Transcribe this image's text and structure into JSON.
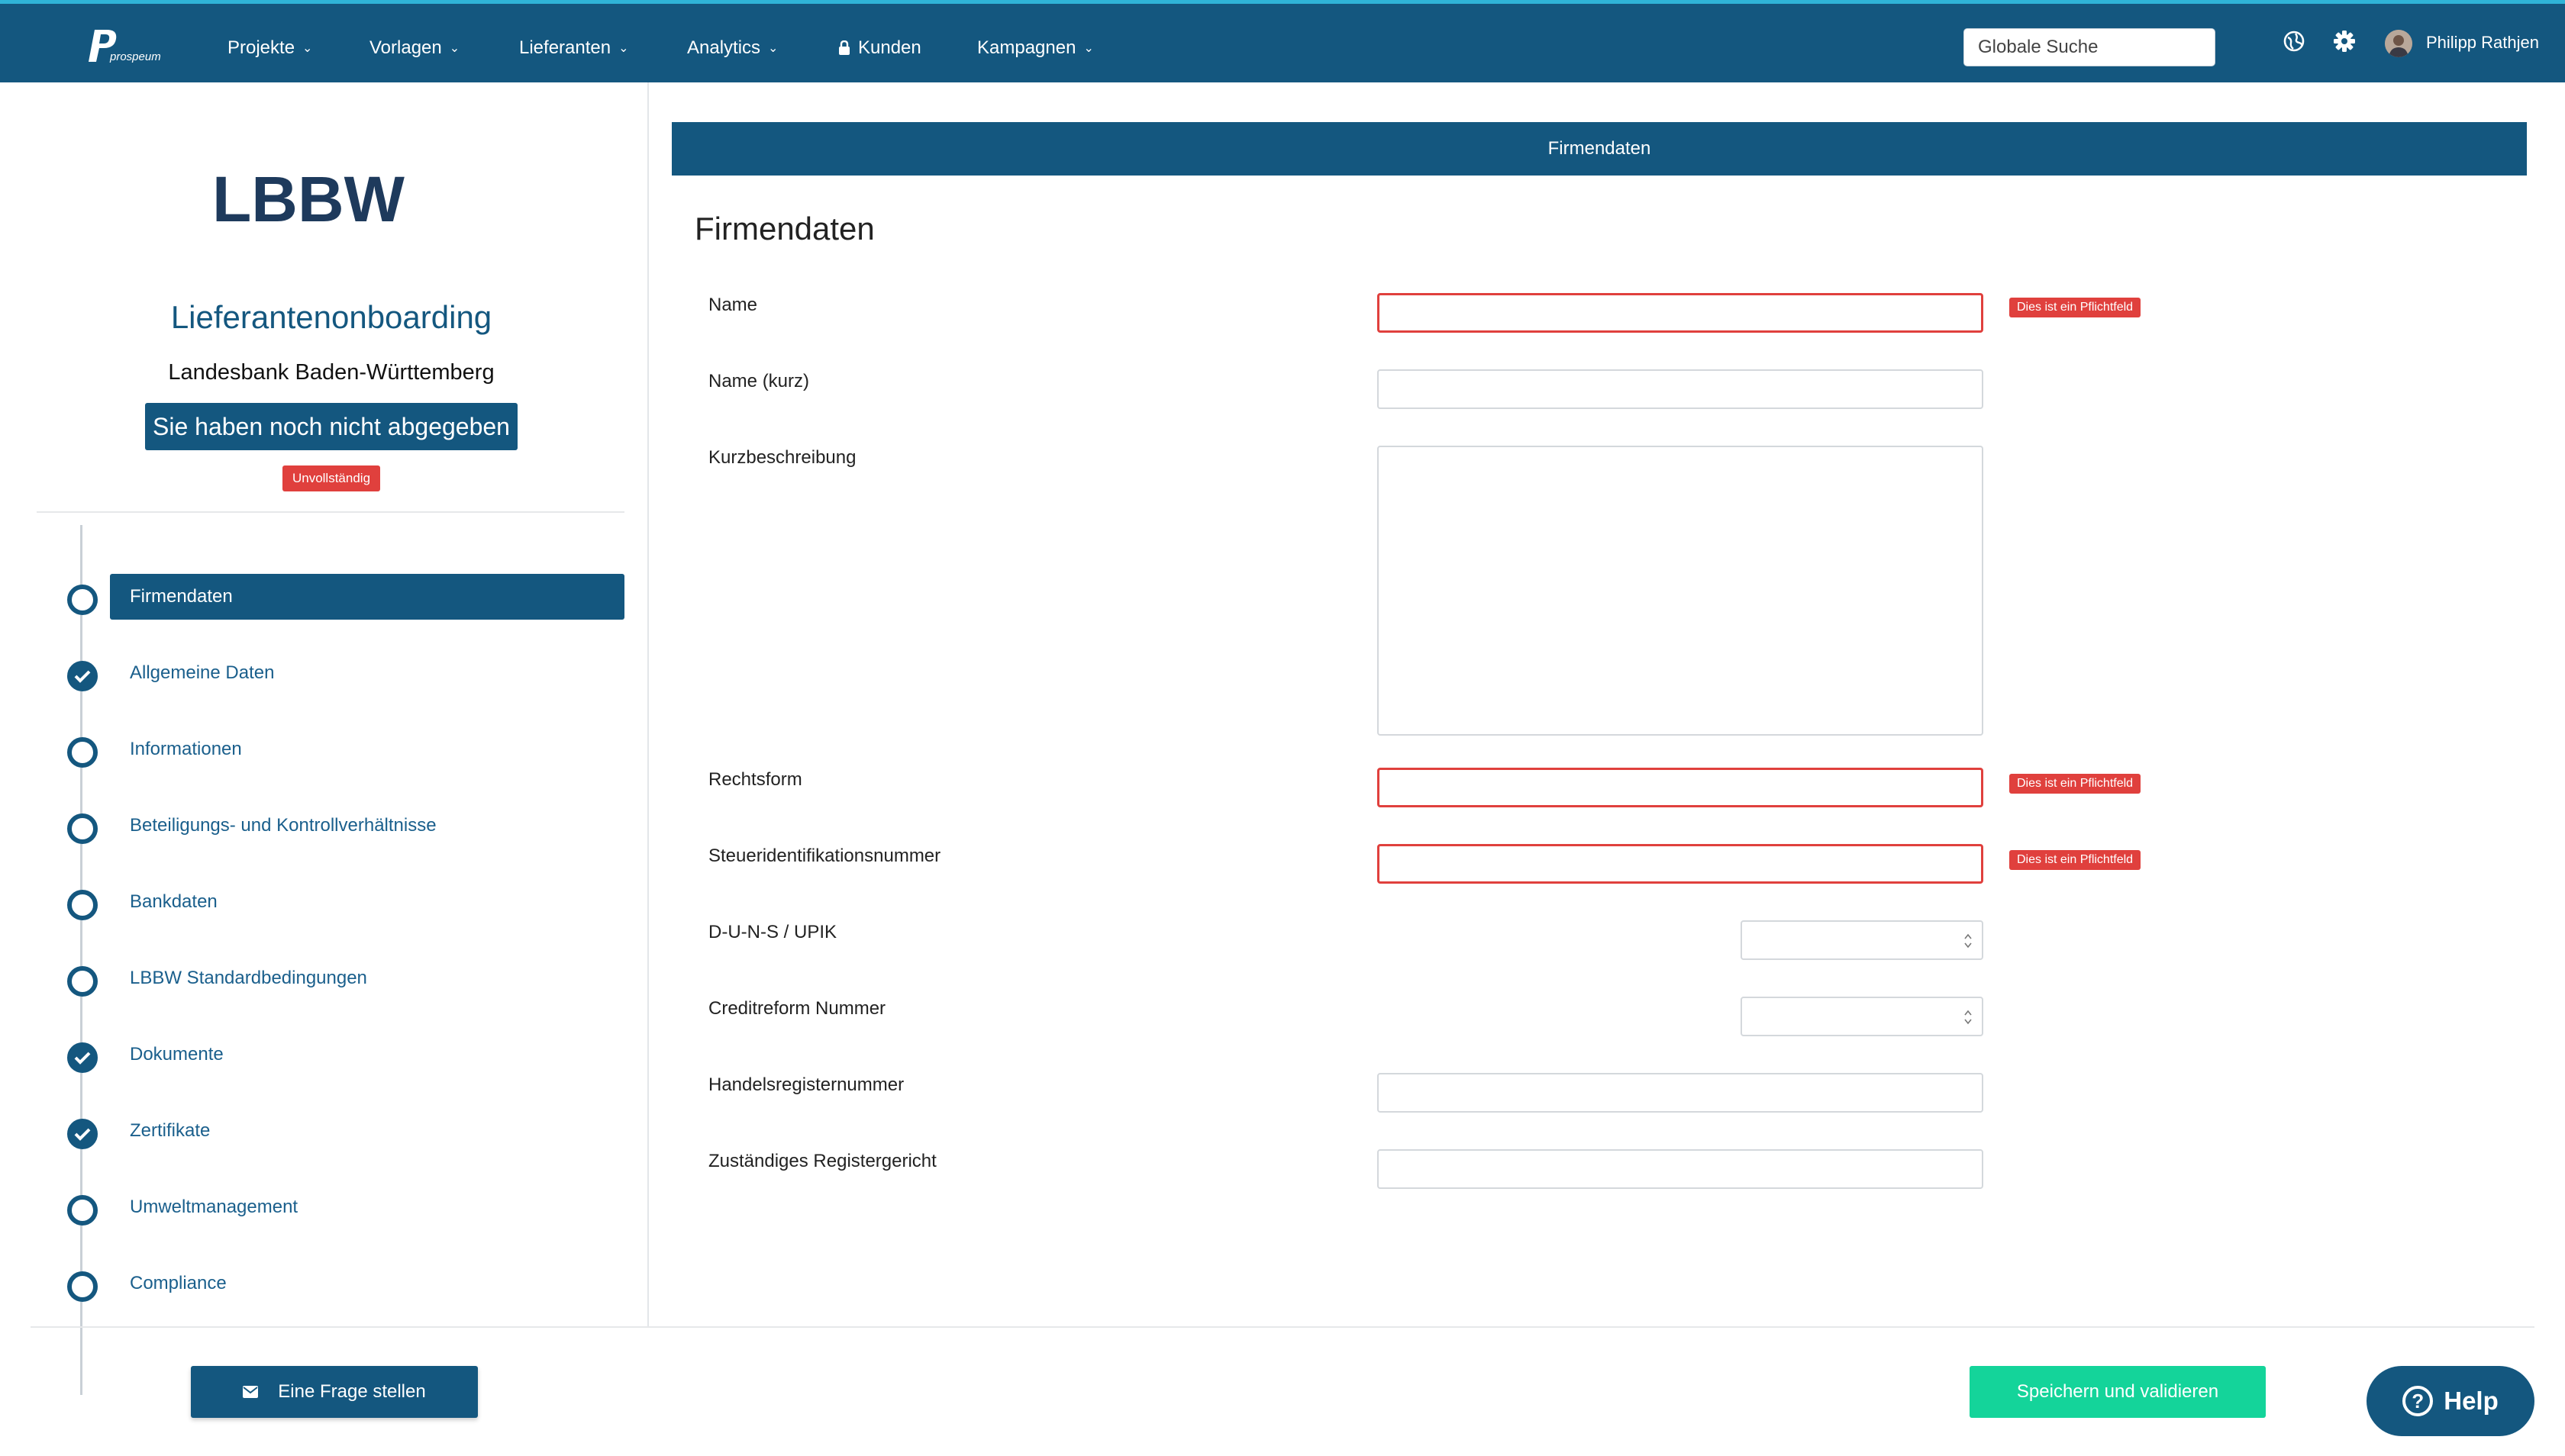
{
  "nav": {
    "logo_text": "prospeum",
    "items": [
      {
        "label": "Projekte",
        "has_caret": true
      },
      {
        "label": "Vorlagen",
        "has_caret": true
      },
      {
        "label": "Lieferanten",
        "has_caret": true
      },
      {
        "label": "Analytics",
        "has_caret": true
      },
      {
        "label": "Kunden",
        "has_caret": false,
        "icon": "lock-icon"
      },
      {
        "label": "Kampagnen",
        "has_caret": true
      }
    ],
    "search_placeholder": "Globale Suche",
    "icons": [
      "globe-icon",
      "gear-icon"
    ],
    "user_name": "Philipp Rathjen"
  },
  "sidebar": {
    "client_logo_text": "LBBW",
    "title": "Lieferantenonboarding",
    "bank_name": "Landesbank Baden-Württemberg",
    "submission_status": "Sie haben noch nicht abgegeben",
    "completion_badge": "Unvollständig",
    "steps": [
      {
        "label": "Firmendaten",
        "done": false,
        "active": true
      },
      {
        "label": "Allgemeine Daten",
        "done": true,
        "active": false
      },
      {
        "label": "Informationen",
        "done": false,
        "active": false
      },
      {
        "label": "Beteiligungs- und Kontrollverhältnisse",
        "done": false,
        "active": false
      },
      {
        "label": "Bankdaten",
        "done": false,
        "active": false
      },
      {
        "label": "LBBW Standardbedingungen",
        "done": false,
        "active": false
      },
      {
        "label": "Dokumente",
        "done": true,
        "active": false
      },
      {
        "label": "Zertifikate",
        "done": true,
        "active": false
      },
      {
        "label": "Umweltmanagement",
        "done": false,
        "active": false
      },
      {
        "label": "Compliance",
        "done": false,
        "active": false
      }
    ]
  },
  "main": {
    "header": "Firmendaten",
    "title": "Firmendaten",
    "required_message": "Dies ist ein Pflichtfeld",
    "fields": [
      {
        "label": "Name",
        "value": "",
        "type": "text",
        "required_error": true
      },
      {
        "label": "Name (kurz)",
        "value": "",
        "type": "text",
        "required_error": false
      },
      {
        "label": "Kurzbeschreibung",
        "value": "",
        "type": "textarea",
        "required_error": false
      },
      {
        "label": "Rechtsform",
        "value": "",
        "type": "text",
        "required_error": true
      },
      {
        "label": "Steueridentifikationsnummer",
        "value": "",
        "type": "text",
        "required_error": true
      },
      {
        "label": "D-U-N-S / UPIK",
        "value": "",
        "type": "number",
        "required_error": false
      },
      {
        "label": "Creditreform Nummer",
        "value": "",
        "type": "number",
        "required_error": false
      },
      {
        "label": "Handelsregisternummer",
        "value": "",
        "type": "text",
        "required_error": false
      },
      {
        "label": "Zuständiges Registergericht",
        "value": "",
        "type": "text",
        "required_error": false
      }
    ]
  },
  "footer": {
    "ask_button": "Eine Frage stellen",
    "save_button": "Speichern und validieren",
    "help_button": "Help"
  },
  "colors": {
    "primary": "#14577f",
    "accent_top": "#2fb4d8",
    "error": "#e0403d",
    "success": "#14d49a"
  }
}
